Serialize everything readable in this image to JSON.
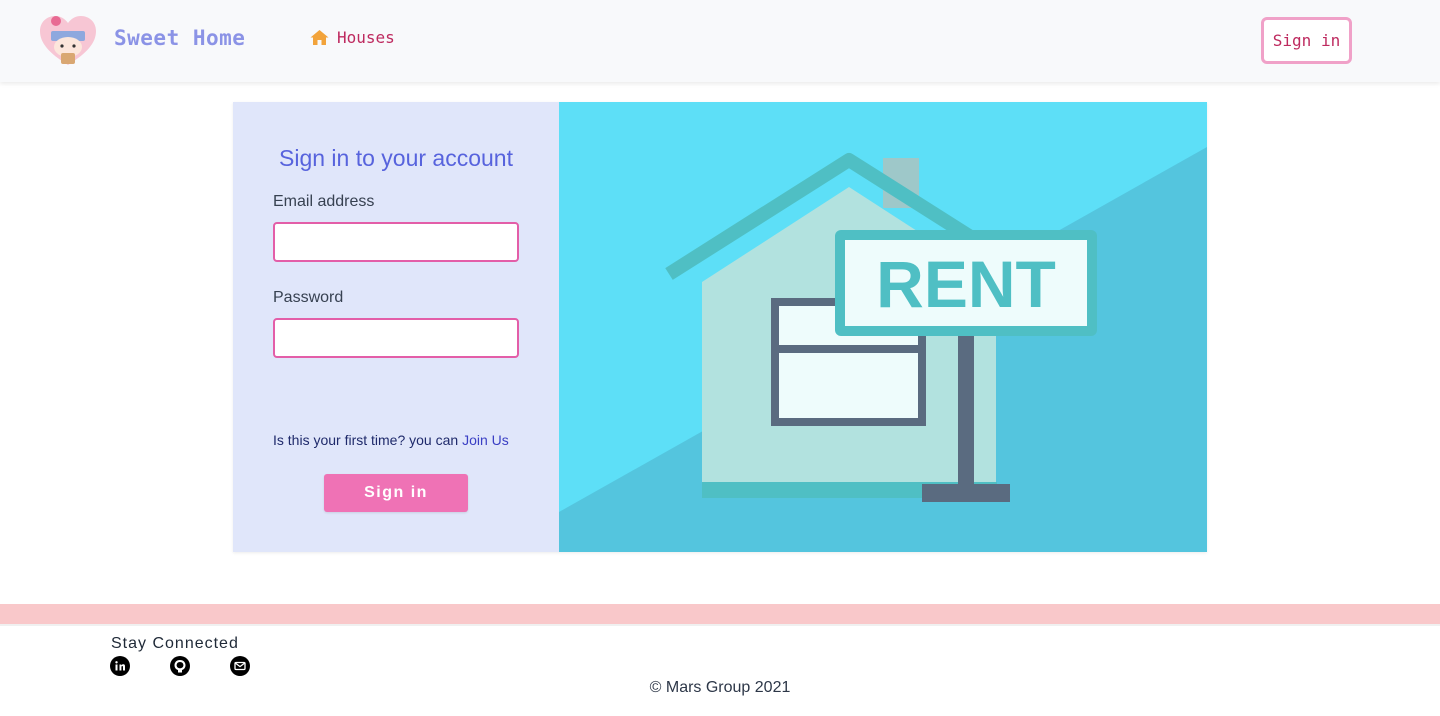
{
  "header": {
    "brand": "Sweet Home",
    "nav_houses": "Houses",
    "signin_label": "Sign in"
  },
  "login": {
    "title": "Sign in to your account",
    "email_label": "Email address",
    "email_value": "",
    "password_label": "Password",
    "password_value": "",
    "first_time_text": "Is this your first time? you can ",
    "join_link": "Join Us",
    "submit_label": "Sign in"
  },
  "illustration": {
    "sign_text": "RENT"
  },
  "footer": {
    "stay_connected": "Stay Connected",
    "social_icons": [
      "linkedin-icon",
      "github-icon",
      "mail-icon"
    ],
    "copyright": "© Mars Group 2021"
  },
  "colors": {
    "brand": "#8b93e6",
    "accent_pink": "#ef72b5",
    "nav_text": "#be2a5f",
    "panel_bg": "#e0e6fa",
    "illustration_bg": "#5ddff7",
    "footer_band": "#f9c8ca"
  }
}
